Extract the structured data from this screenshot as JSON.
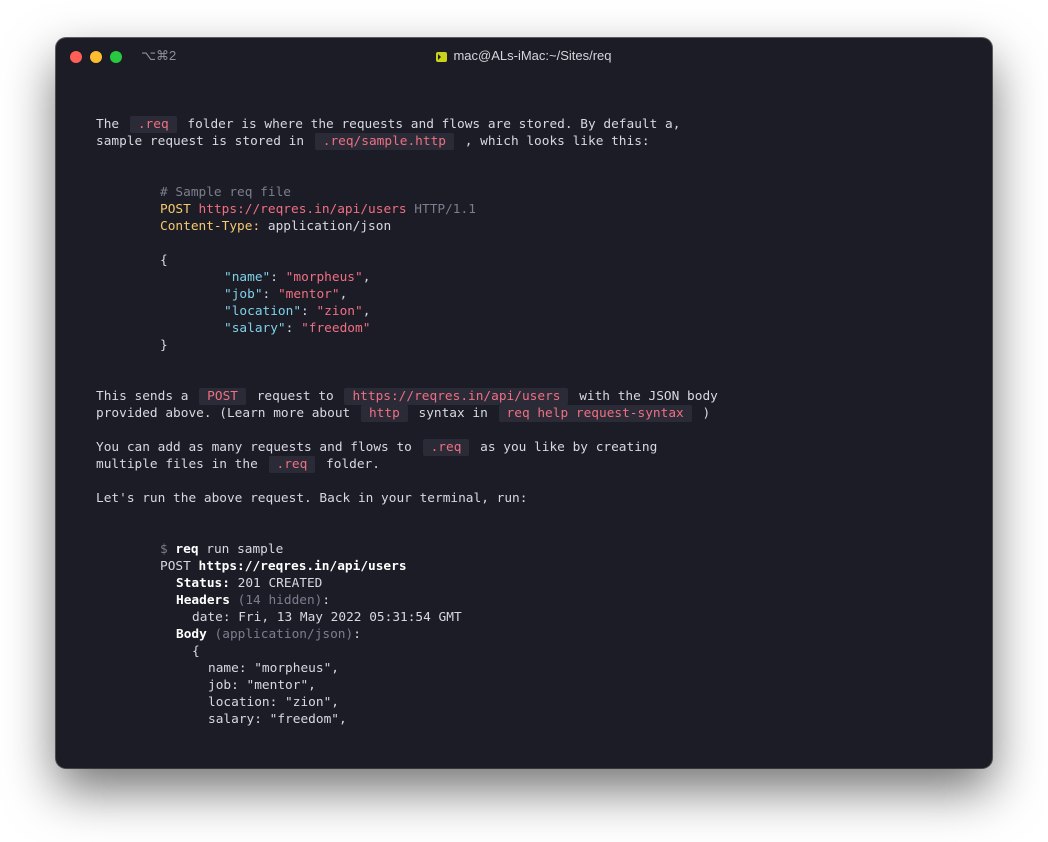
{
  "window": {
    "title": "mac@ALs-iMac:~/Sites/req",
    "shortcut": "⌥⌘2",
    "icon": "terminal-icon"
  },
  "para1": {
    "l1a": "The ",
    "l1code": ".req",
    "l1b": " folder is where the requests and flows are stored. By default a,",
    "l2a": "sample request is stored in ",
    "l2code": ".req/sample.http",
    "l2b": " , which looks like this:"
  },
  "sample": {
    "comment": "# Sample req file",
    "method": "POST",
    "url": "https://reqres.in/api/users",
    "version": " HTTP/1.1",
    "header_key": "Content-Type:",
    "header_val": " application/json",
    "open": "{",
    "fields": [
      {
        "key": "\"name\"",
        "val": "\"morpheus\"",
        "end": ","
      },
      {
        "key": "\"job\"",
        "val": "\"mentor\"",
        "end": ","
      },
      {
        "key": "\"location\"",
        "val": "\"zion\"",
        "end": ","
      },
      {
        "key": "\"salary\"",
        "val": "\"freedom\"",
        "end": ""
      }
    ],
    "close": "}"
  },
  "para2": {
    "l1a": "This sends a ",
    "l1c1": "POST",
    "l1b": " request to ",
    "l1c2": "https://reqres.in/api/users",
    "l1d": " with the JSON body",
    "l2a": "provided above. (Learn more about ",
    "l2c1": "http",
    "l2b": " syntax in ",
    "l2c2": "req help request-syntax",
    "l2d": " )"
  },
  "para3": {
    "l1a": "You can add as many requests and flows to ",
    "l1c": ".req",
    "l1b": " as you like by creating",
    "l2a": "multiple files in the ",
    "l2c": ".req",
    "l2b": " folder."
  },
  "para4": "Let's run the above request. Back in your terminal, run:",
  "run": {
    "prompt": "$ ",
    "cmd": "req",
    "args": " run sample",
    "method": "POST ",
    "url": "https://reqres.in/api/users",
    "status_label": "Status:",
    "status_val": " 201 CREATED",
    "headers_label": "Headers",
    "headers_note": " (14 hidden)",
    "headers_colon": ":",
    "date_line": "date: Fri, 13 May 2022 05:31:54 GMT",
    "body_label": "Body",
    "body_note": " (application/json)",
    "body_colon": ":",
    "open": "{",
    "fields": [
      "name: \"morpheus\",",
      "job: \"mentor\",",
      "location: \"zion\",",
      "salary: \"freedom\","
    ]
  },
  "colors": {
    "background": "#1b1c26",
    "inline_code_bg": "#2a2b37",
    "pink": "#f06f82",
    "yellow": "#f5c96d",
    "cyan": "#7fd1e8",
    "comment": "#7b7e8c"
  }
}
